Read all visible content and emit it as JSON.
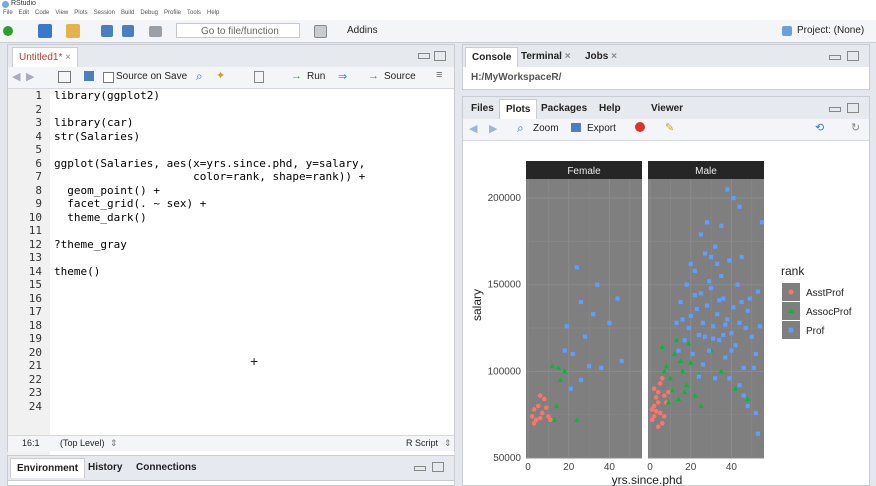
{
  "window": {
    "title": "RStudio"
  },
  "menu": [
    "File",
    "Edit",
    "Code",
    "View",
    "Plots",
    "Session",
    "Build",
    "Debug",
    "Profile",
    "Tools",
    "Help"
  ],
  "toolbar": {
    "goto_placeholder": "Go to file/function",
    "addins_label": "Addins",
    "project_label": "Project: (None)"
  },
  "editor": {
    "tab_label": "Untitled1*",
    "source_on_save_label": "Source on Save",
    "run_label": "Run",
    "source_label": "Source",
    "line_numbers": [
      "1",
      "2",
      "3",
      "4",
      "5",
      "6",
      "7",
      "8",
      "9",
      "10",
      "11",
      "12",
      "13",
      "14",
      "15",
      "16",
      "17",
      "18",
      "19",
      "20",
      "21",
      "22",
      "23",
      "24"
    ],
    "lines": [
      "library(ggplot2)",
      "",
      "library(car)",
      "str(Salaries)",
      "",
      "ggplot(Salaries, aes(x=yrs.since.phd, y=salary,",
      "                     color=rank, shape=rank)) +",
      "  geom_point() +",
      "  facet_grid(. ~ sex) +",
      "  theme_dark()",
      "",
      "?theme_gray",
      "",
      "theme()",
      "",
      "",
      "",
      "",
      "",
      "",
      "",
      "",
      "",
      ""
    ],
    "cursor_pos": "16:1",
    "scope": "(Top Level)",
    "file_type": "R Script"
  },
  "env_pane": {
    "tabs": [
      "Environment",
      "History",
      "Connections"
    ]
  },
  "console_pane": {
    "tabs": [
      "Console",
      "Terminal",
      "Jobs"
    ],
    "path": "H:/MyWorkspaceR/"
  },
  "files_pane": {
    "tabs": [
      "Files",
      "Plots",
      "Packages",
      "Help",
      "Viewer"
    ],
    "zoom_label": "Zoom",
    "export_label": "Export"
  },
  "chart_data": {
    "type": "scatter",
    "facets": [
      "Female",
      "Male"
    ],
    "xlabel": "yrs.since.phd",
    "ylabel": "salary",
    "x_ticks": [
      "0",
      "20",
      "40"
    ],
    "y_ticks": [
      "50000",
      "100000",
      "150000",
      "200000"
    ],
    "xlim": [
      -1,
      56
    ],
    "ylim": [
      50000,
      211000
    ],
    "legend_title": "rank",
    "legend_position": "right",
    "theme": "dark",
    "series": [
      {
        "name": "AsstProf",
        "color": "#f8766d",
        "shape": "circle",
        "points": {
          "Female": [
            [
              2,
              74000
            ],
            [
              3,
              78000
            ],
            [
              4,
              72000
            ],
            [
              5,
              80000
            ],
            [
              6,
              73000
            ],
            [
              7,
              76000
            ],
            [
              8,
              84000
            ],
            [
              9,
              79000
            ],
            [
              10,
              74000
            ],
            [
              3,
              70000
            ],
            [
              6,
              86000
            ],
            [
              11,
              72000
            ]
          ],
          "Male": [
            [
              1,
              72000
            ],
            [
              2,
              80000
            ],
            [
              3,
              77000
            ],
            [
              4,
              82000
            ],
            [
              5,
              76000
            ],
            [
              6,
              70000
            ],
            [
              7,
              86000
            ],
            [
              2,
              90000
            ],
            [
              4,
              68000
            ],
            [
              5,
              93000
            ],
            [
              8,
              82000
            ],
            [
              3,
              85000
            ],
            [
              6,
              96000
            ],
            [
              1,
              78000
            ],
            [
              7,
              74000
            ],
            [
              9,
              88000
            ],
            [
              4,
              88000
            ],
            [
              2,
              74000
            ]
          ]
        }
      },
      {
        "name": "AssocProf",
        "color": "#00ba38",
        "shape": "triangle",
        "points": {
          "Female": [
            [
              12,
              103000
            ],
            [
              14,
              80000
            ],
            [
              16,
              95000
            ],
            [
              13,
              72000
            ],
            [
              18,
              100000
            ],
            [
              24,
              72000
            ],
            [
              15,
              102000
            ]
          ],
          "Male": [
            [
              8,
              103000
            ],
            [
              10,
              96000
            ],
            [
              12,
              110000
            ],
            [
              14,
              84000
            ],
            [
              16,
              100000
            ],
            [
              18,
              92000
            ],
            [
              20,
              105000
            ],
            [
              22,
              86000
            ],
            [
              24,
              98000
            ],
            [
              11,
              89000
            ],
            [
              13,
              118000
            ],
            [
              9,
              82000
            ],
            [
              15,
              106000
            ],
            [
              17,
              88000
            ],
            [
              25,
              80000
            ],
            [
              30,
              112000
            ],
            [
              35,
              100000
            ],
            [
              42,
              90000
            ],
            [
              48,
              84000
            ],
            [
              6,
              114000
            ],
            [
              7,
              100000
            ],
            [
              19,
              116000
            ]
          ]
        }
      },
      {
        "name": "Prof",
        "color": "#619cff",
        "shape": "square",
        "points": {
          "Female": [
            [
              19,
              126000
            ],
            [
              22,
              110000
            ],
            [
              24,
              160000
            ],
            [
              26,
              140000
            ],
            [
              28,
              120000
            ],
            [
              34,
              150000
            ],
            [
              36,
              102000
            ],
            [
              40,
              128000
            ],
            [
              46,
              106000
            ],
            [
              18,
              112000
            ],
            [
              26,
              95000
            ],
            [
              30,
              103000
            ],
            [
              44,
              142000
            ],
            [
              21,
              90000
            ],
            [
              32,
              133000
            ]
          ],
          "Male": [
            [
              13,
              128000
            ],
            [
              15,
              140000
            ],
            [
              17,
              118000
            ],
            [
              18,
              150000
            ],
            [
              20,
              132000
            ],
            [
              22,
              158000
            ],
            [
              24,
              121000
            ],
            [
              25,
              145000
            ],
            [
              26,
              104000
            ],
            [
              27,
              168000
            ],
            [
              28,
              138000
            ],
            [
              29,
              112000
            ],
            [
              30,
              148000
            ],
            [
              31,
              126000
            ],
            [
              32,
              172000
            ],
            [
              33,
              133000
            ],
            [
              34,
              118000
            ],
            [
              35,
              155000
            ],
            [
              36,
              142000
            ],
            [
              37,
              108000
            ],
            [
              38,
              130000
            ],
            [
              39,
              164000
            ],
            [
              40,
              122000
            ],
            [
              41,
              137000
            ],
            [
              42,
              115000
            ],
            [
              43,
              150000
            ],
            [
              44,
              128000
            ],
            [
              45,
              140000
            ],
            [
              46,
              102000
            ],
            [
              47,
              125000
            ],
            [
              48,
              135000
            ],
            [
              50,
              120000
            ],
            [
              52,
              110000
            ],
            [
              53,
              146000
            ],
            [
              54,
              126000
            ],
            [
              38,
              205000
            ],
            [
              41,
              200000
            ],
            [
              44,
              195000
            ],
            [
              25,
              179000
            ],
            [
              35,
              184000
            ],
            [
              30,
              166000
            ],
            [
              28,
              186000
            ],
            [
              19,
              125000
            ],
            [
              21,
              110000
            ],
            [
              23,
              136000
            ],
            [
              26,
              128000
            ],
            [
              29,
              152000
            ],
            [
              31,
              119000
            ],
            [
              33,
              162000
            ],
            [
              36,
              121000
            ],
            [
              20,
              162000
            ],
            [
              24,
              97000
            ],
            [
              32,
              96000
            ],
            [
              48,
              80000
            ],
            [
              52,
              76000
            ],
            [
              39,
              96000
            ],
            [
              44,
              92000
            ],
            [
              55,
              186000
            ],
            [
              49,
              142000
            ],
            [
              27,
              120000
            ],
            [
              34,
              141000
            ],
            [
              37,
              127000
            ],
            [
              40,
              112000
            ],
            [
              22,
              144000
            ],
            [
              16,
              130000
            ],
            [
              14,
              112000
            ],
            [
              45,
              166000
            ],
            [
              51,
              102000
            ],
            [
              53,
              64000
            ],
            [
              46,
              86000
            ]
          ]
        }
      }
    ]
  }
}
